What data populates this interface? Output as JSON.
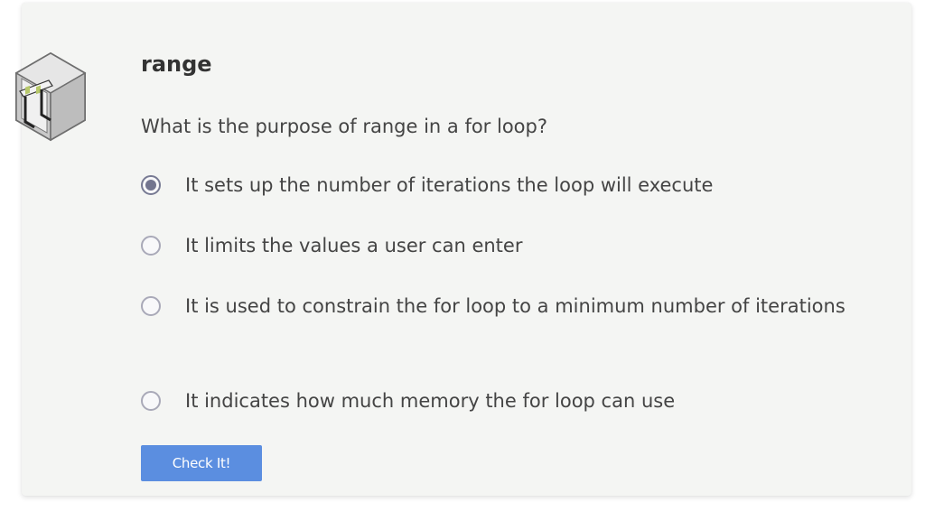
{
  "quiz": {
    "title": "range",
    "question": "What is the purpose of range in a for loop?",
    "options": [
      {
        "label": "It sets up the number of iterations the loop will execute",
        "selected": true
      },
      {
        "label": "It limits the values a user can enter",
        "selected": false
      },
      {
        "label": "It is used to constrain the for loop to a minimum number of iterations",
        "selected": false
      },
      {
        "label": "It indicates how much memory the for loop can use",
        "selected": false
      }
    ],
    "submit_label": "Check It!"
  },
  "colors": {
    "card_bg": "#f4f5f3",
    "button_bg": "#5b8ee0",
    "radio_selected": "#73758f",
    "text": "#444444"
  },
  "icons": {
    "logo": "hurdle-box-icon"
  }
}
